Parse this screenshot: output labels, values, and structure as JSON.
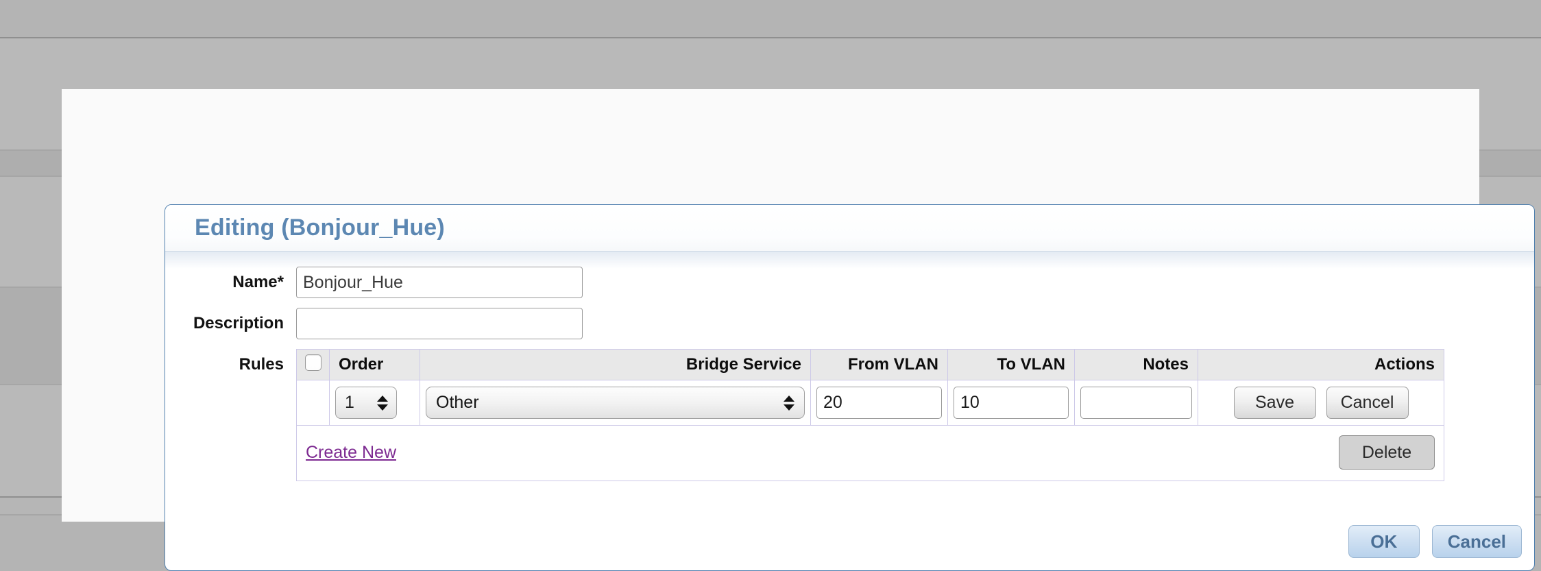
{
  "dialog": {
    "title": "Editing (Bonjour_Hue)"
  },
  "form": {
    "name": {
      "label": "Name*",
      "value": "Bonjour_Hue",
      "placeholder": ""
    },
    "description": {
      "label": "Description",
      "value": "",
      "placeholder": ""
    },
    "rules": {
      "label": "Rules"
    }
  },
  "rules_table": {
    "columns": [
      "",
      "Order",
      "Bridge Service",
      "From VLAN",
      "To VLAN",
      "Notes",
      "Actions"
    ],
    "rows": [
      {
        "order": "1",
        "bridge_service": "Other",
        "bridge_service_extra": "",
        "from_vlan": "20",
        "to_vlan": "10",
        "notes": "",
        "save_label": "Save",
        "cancel_label": "Cancel"
      }
    ],
    "footer": {
      "create_new_label": "Create New",
      "delete_label": "Delete"
    }
  },
  "dialog_buttons": {
    "ok_label": "OK",
    "cancel_label": "Cancel"
  },
  "colors": {
    "title_blue": "#5c87b2",
    "panel_border": "#4e7fae",
    "table_border": "#cdc9e8",
    "header_bg": "#e8e8e8",
    "link_purple": "#7d2a91",
    "primary_button_text": "#4a6f96",
    "backdrop": "#b4b4b4"
  }
}
